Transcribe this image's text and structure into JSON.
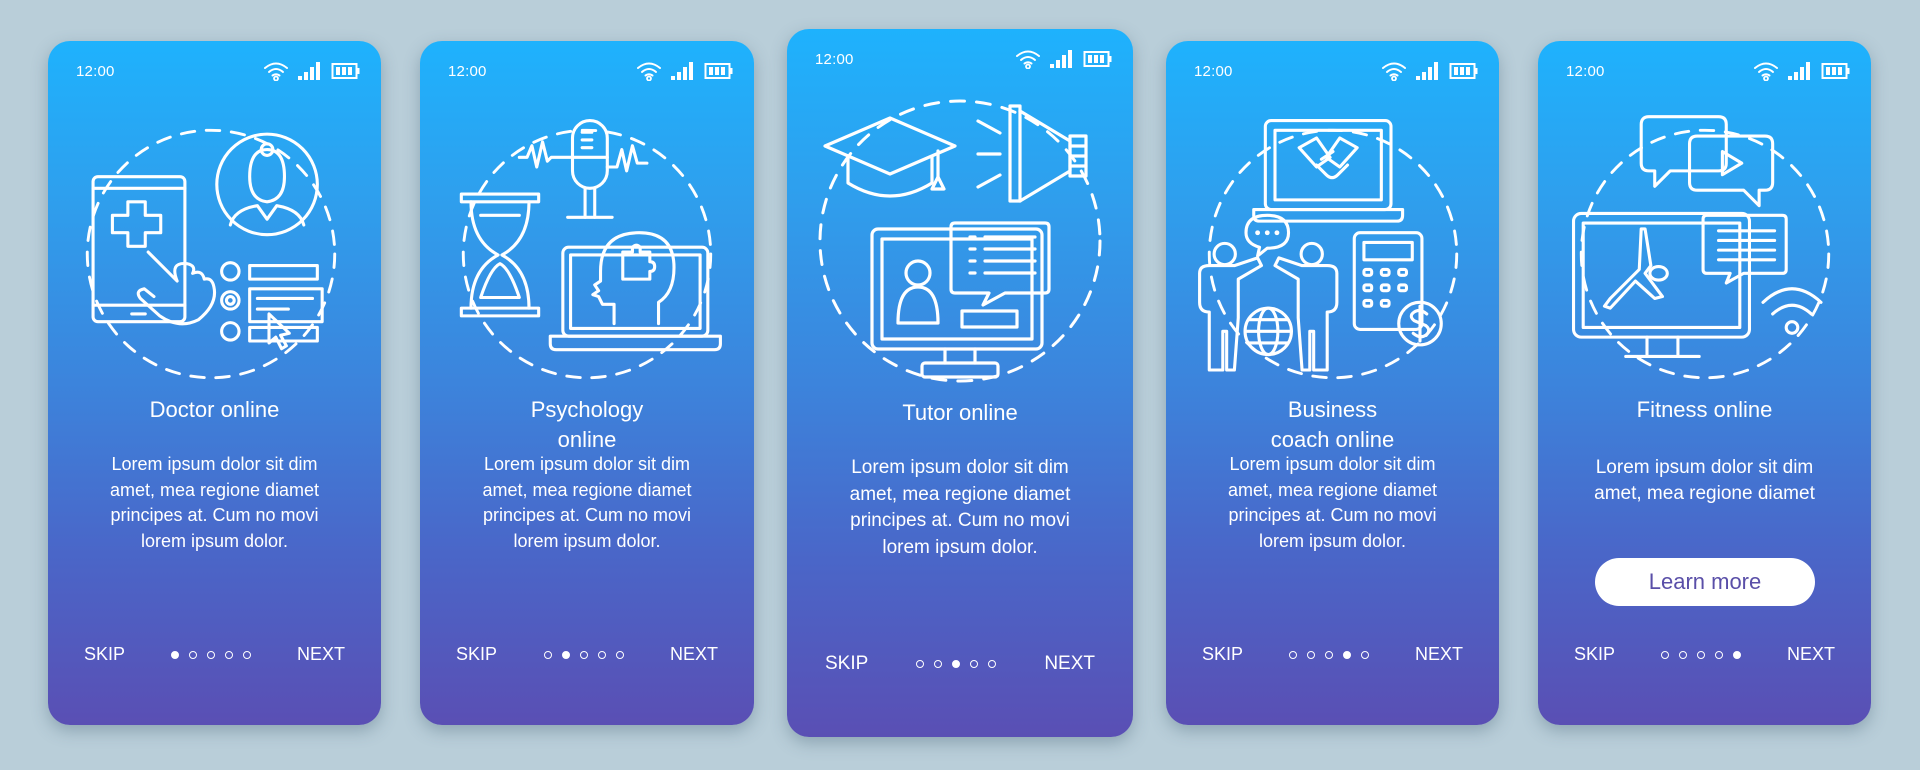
{
  "status_bar": {
    "time": "12:00",
    "icons": [
      "wifi-icon",
      "signal-icon",
      "battery-icon"
    ]
  },
  "footer": {
    "skip_label": "SKIP",
    "next_label": "NEXT",
    "total_pages": 5
  },
  "accent": {
    "gradient_top": "#1eb2fd",
    "gradient_bottom": "#5a4fb4",
    "background": "#b9ced9",
    "button_text": "#5a4fa8"
  },
  "screens": [
    {
      "title_lines": [
        "Doctor online"
      ],
      "body_lines": [
        "Lorem ipsum dolor sit dim",
        "amet, mea regione diamet",
        "principes at. Cum no movi",
        "lorem ipsum dolor."
      ],
      "active_page": 1,
      "illustration": "doctor-online-illustration"
    },
    {
      "title_lines": [
        "Psychology",
        "online"
      ],
      "body_lines": [
        "Lorem ipsum dolor sit dim",
        "amet, mea regione diamet",
        "principes at. Cum no movi",
        "lorem ipsum dolor."
      ],
      "active_page": 2,
      "illustration": "psychology-online-illustration"
    },
    {
      "title_lines": [
        "Tutor online"
      ],
      "body_lines": [
        "Lorem ipsum dolor sit dim",
        "amet, mea regione diamet",
        "principes at. Cum no movi",
        "lorem ipsum dolor."
      ],
      "active_page": 3,
      "illustration": "tutor-online-illustration"
    },
    {
      "title_lines": [
        "Business",
        "coach online"
      ],
      "body_lines": [
        "Lorem ipsum dolor sit dim",
        "amet, mea regione diamet",
        "principes at. Cum no movi",
        "lorem ipsum dolor."
      ],
      "active_page": 4,
      "illustration": "business-coach-illustration"
    },
    {
      "title_lines": [
        "Fitness online"
      ],
      "body_lines": [
        "Lorem ipsum dolor sit dim",
        "amet, mea regione diamet"
      ],
      "active_page": 5,
      "illustration": "fitness-online-illustration",
      "button_label": "Learn more"
    }
  ]
}
